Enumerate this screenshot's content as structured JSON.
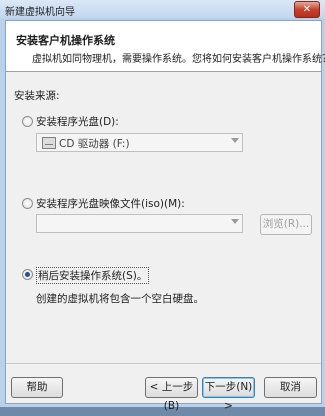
{
  "window": {
    "title": "新建虚拟机向导",
    "close_glyph": "✕"
  },
  "header": {
    "title": "安装客户机操作系统",
    "subtitle": "虚拟机如同物理机，需要操作系统。您将如何安装客户机操作系统？"
  },
  "install_source": {
    "label": "安装来源:",
    "options": [
      {
        "label": "安装程序光盘(D):",
        "selected": false
      },
      {
        "label": "安装程序光盘映像文件(iso)(M):",
        "selected": false
      },
      {
        "label": "稍后安装操作系统(S)。",
        "selected": true
      }
    ],
    "drive_select_value": "CD 驱动器 (F:)",
    "iso_input_value": "",
    "browse_label": "浏览(R)...",
    "later_description": "创建的虚拟机将包含一个空白硬盘。"
  },
  "footer": {
    "help": "帮助",
    "back": "< 上一步(B)",
    "next": "下一步(N) >",
    "cancel": "取消"
  },
  "colors": {
    "header_bg": "#ffffff",
    "panel_bg": "#f0f0f0",
    "frame": "#b9d1ea",
    "close": "#c8412c"
  }
}
